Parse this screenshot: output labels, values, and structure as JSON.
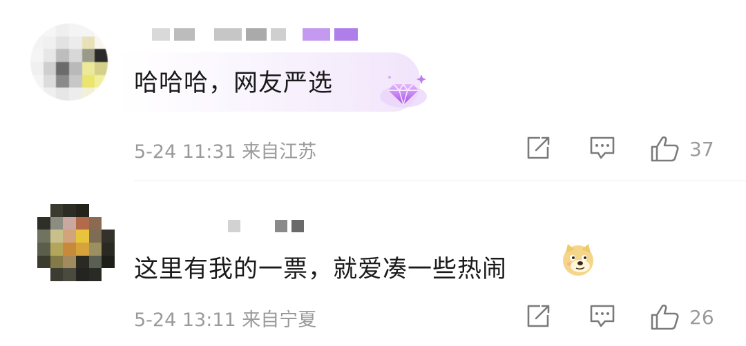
{
  "comments": [
    {
      "text": "哈哈哈，网友严选",
      "date": "5-24",
      "time": "11:31",
      "location": "来自江苏",
      "likes": "37",
      "badge_icon": "purple-diamond-badge-icon"
    },
    {
      "text": "这里有我的一票，就爱凑一些热闹",
      "date": "5-24",
      "time": "13:11",
      "location": "来自宁夏",
      "likes": "26",
      "emoji_icon": "doge-emoji-icon"
    }
  ],
  "icons": {
    "share": "share-icon",
    "reply": "comment-icon",
    "like": "thumbs-up-icon"
  },
  "colors": {
    "meta_text": "#9a9a9a",
    "badge_purple": "#b35cf0",
    "bubble_tint": "#f1e4fb"
  }
}
